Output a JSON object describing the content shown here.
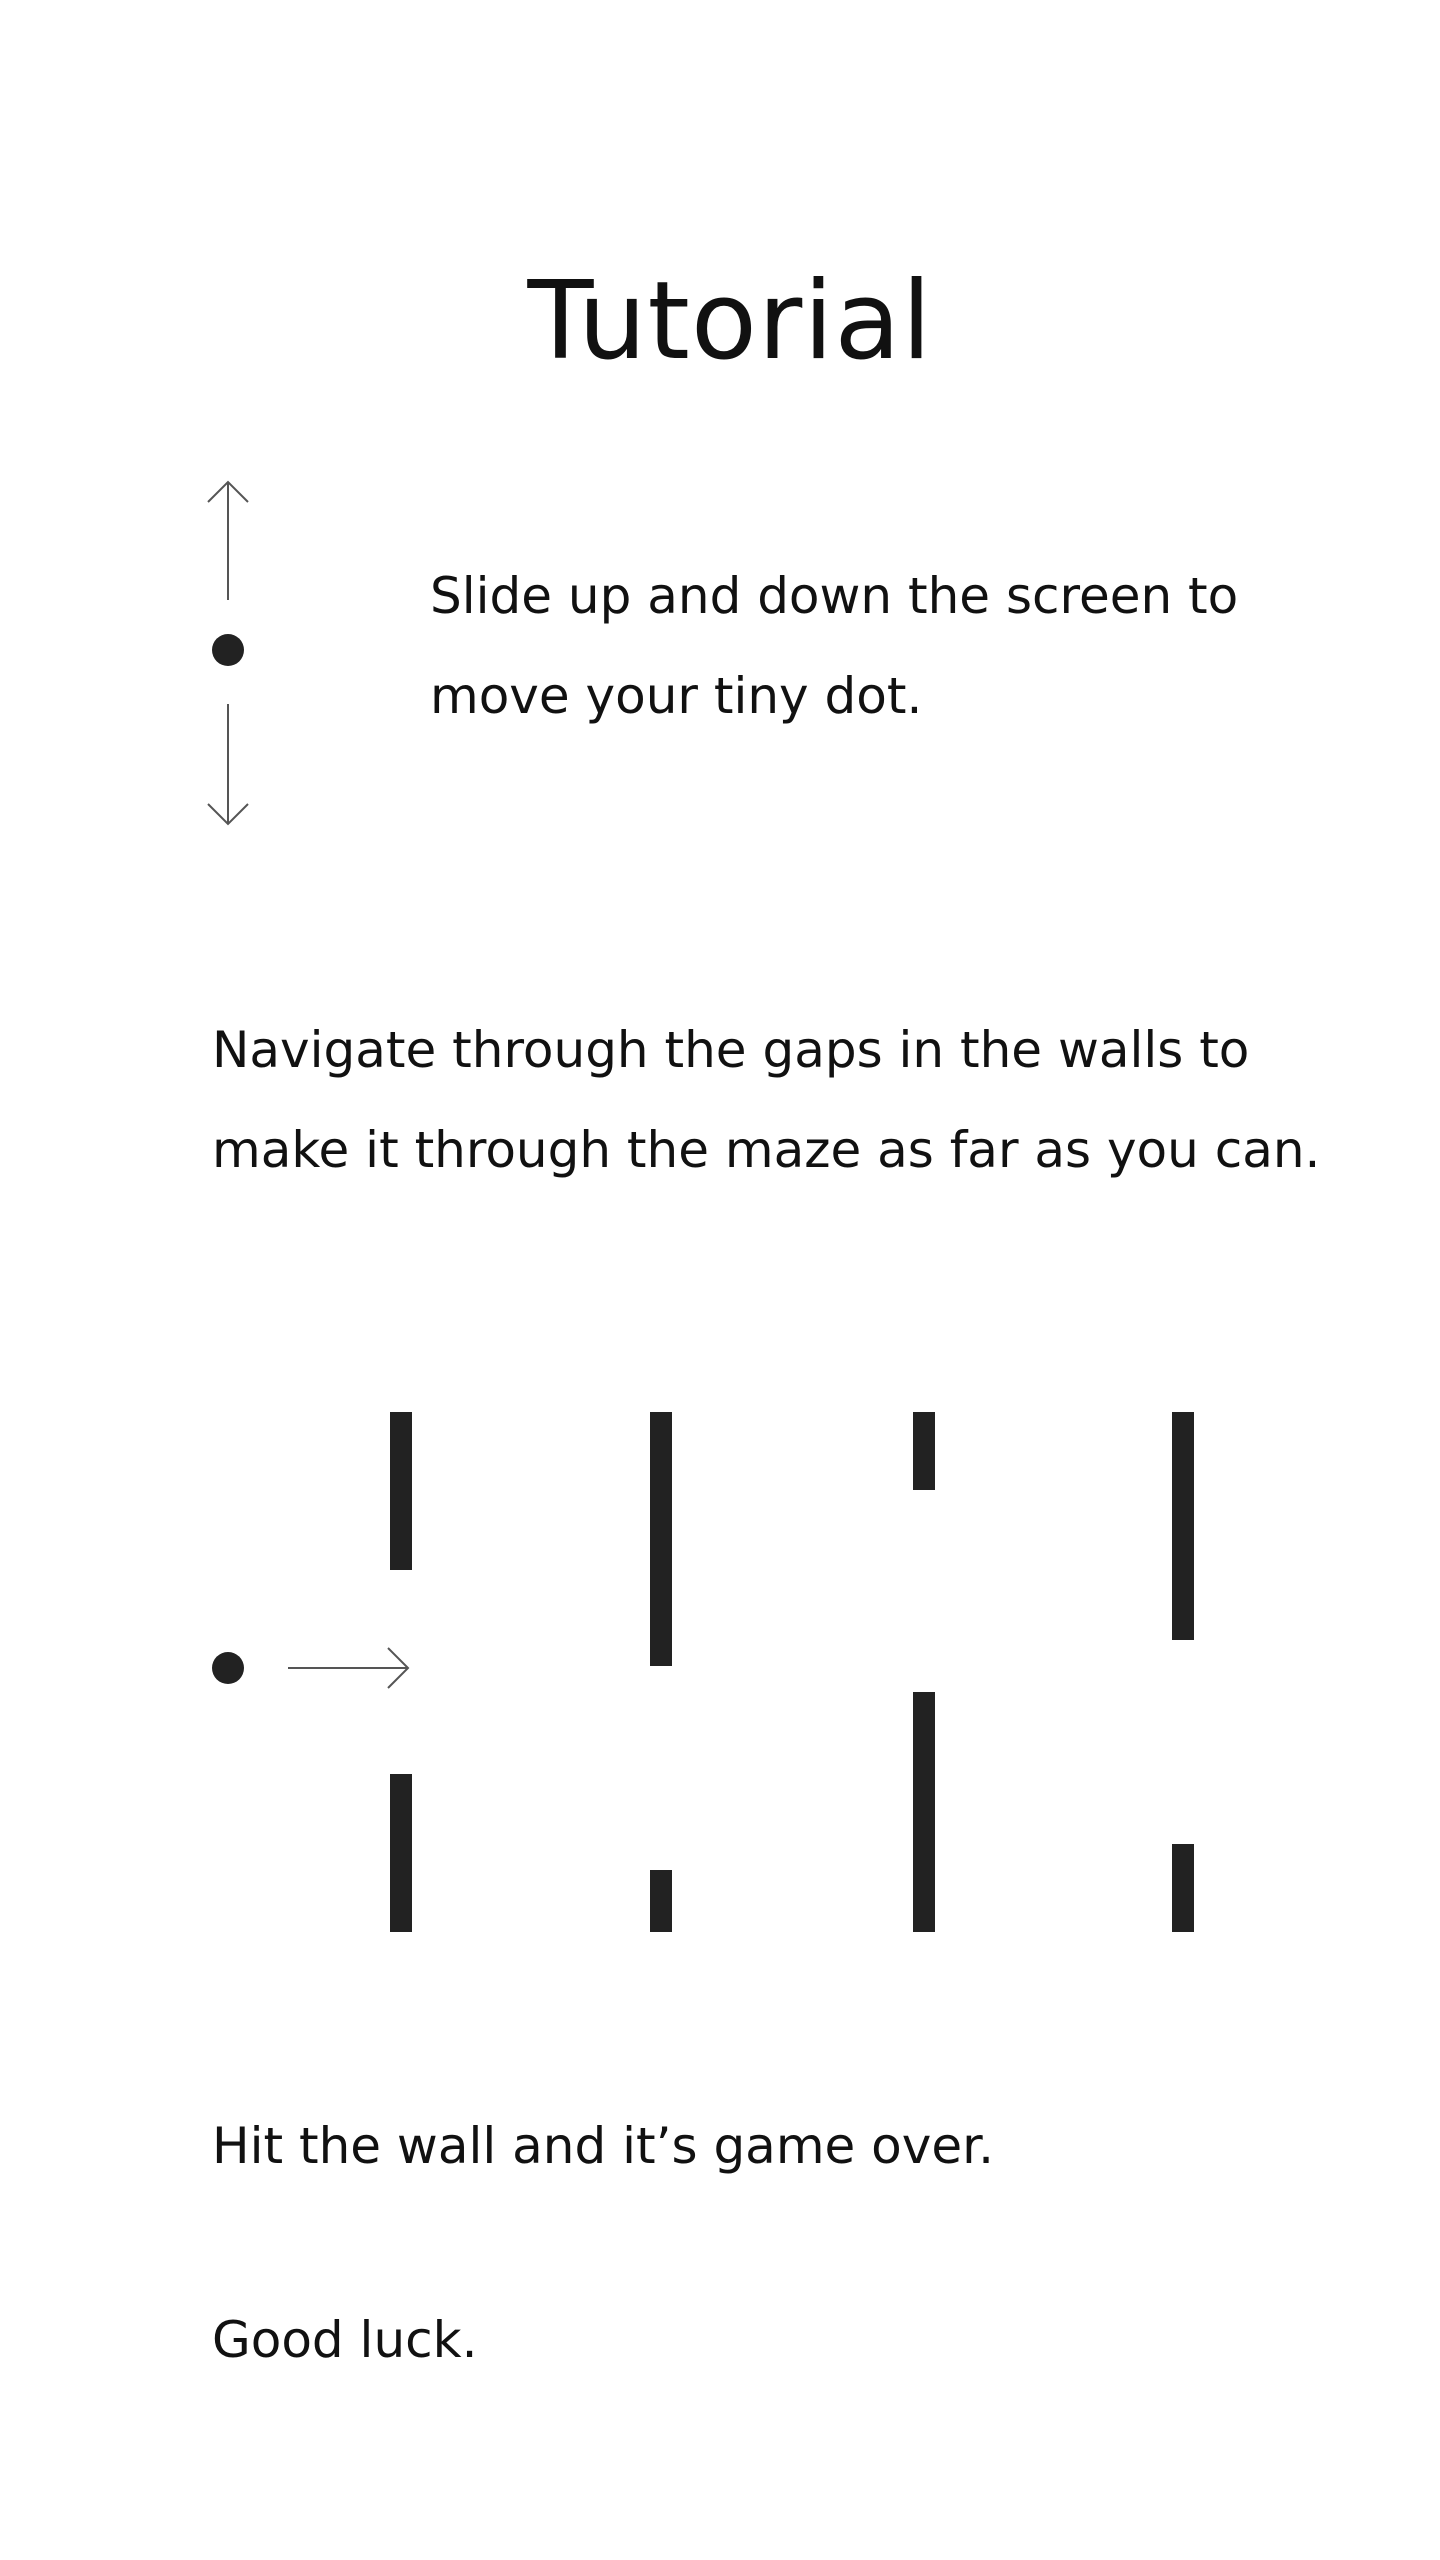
{
  "screen": {
    "title": "Tutorial",
    "instructions": {
      "slide": "Slide up and down the screen to move your tiny dot.",
      "navigate": "Navigate through the gaps in the walls to make it through the maze as far as you can.",
      "game_over": "Hit the wall and it’s game over.",
      "good_luck": "Good luck."
    }
  },
  "colors": {
    "background": "#ffffff",
    "text": "#111111",
    "dot": "#222222",
    "wall": "#222222",
    "arrow": "#555555"
  },
  "icons": {
    "vertical_control": [
      "arrow-up-icon",
      "player-dot-icon",
      "arrow-down-icon"
    ],
    "maze_demo": [
      "player-dot-icon",
      "arrow-right-icon",
      "maze-wall"
    ]
  }
}
